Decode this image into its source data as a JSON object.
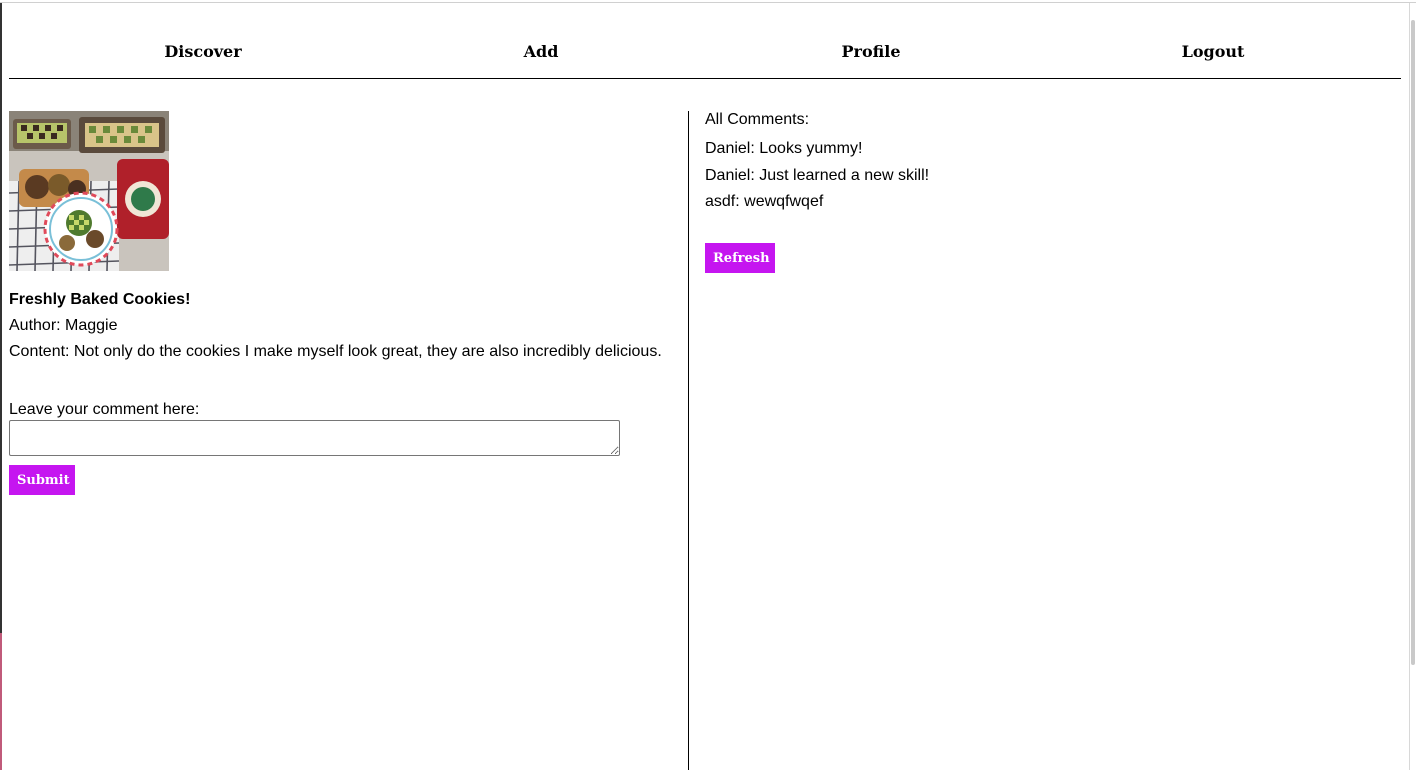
{
  "nav": {
    "items": [
      {
        "label": "Discover"
      },
      {
        "label": "Add"
      },
      {
        "label": "Profile"
      },
      {
        "label": "Logout"
      }
    ]
  },
  "post": {
    "image_alt": "cookies",
    "title": "Freshly Baked Cookies!",
    "author": "Author: Maggie",
    "content": "Content: Not only do the cookies I make myself look great, they are also incredibly delicious."
  },
  "comment_form": {
    "label": "Leave your comment here:",
    "value": "",
    "submit_label": "Submit"
  },
  "comments": {
    "heading": "All Comments:",
    "items": [
      {
        "text": "Daniel: Looks yummy!"
      },
      {
        "text": "Daniel: Just learned a new skill!"
      },
      {
        "text": "asdf: wewqfwqef"
      }
    ],
    "refresh_label": "Refresh"
  },
  "colors": {
    "button_bg": "#c515f0",
    "button_text": "#ffffff"
  }
}
